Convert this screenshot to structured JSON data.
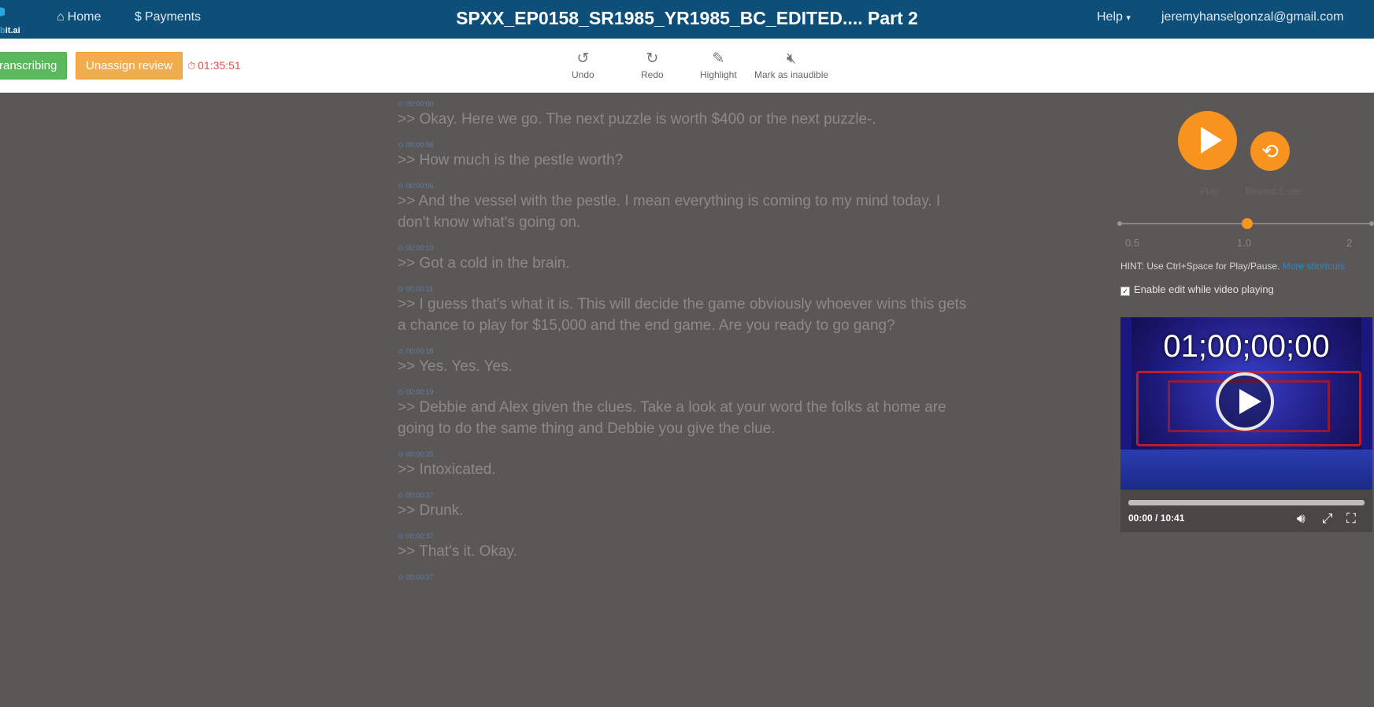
{
  "nav": {
    "logo_prefix": "b",
    "logo_suffix": "it.ai",
    "home": "Home",
    "payments": "Payments",
    "title": "SPXX_EP0158_SR1985_YR1985_BC_EDITED.... Part 2",
    "help": "Help",
    "help_caret": "▾",
    "user": "jeremyhanselgonzal@gmail.com"
  },
  "toolbar": {
    "transcribing": "ranscribing",
    "unassign": "Unassign review",
    "timer": "01:35:51",
    "undo": "Undo",
    "redo": "Redo",
    "highlight": "Highlight",
    "inaudible": "Mark as inaudible"
  },
  "transcript": [
    {
      "time": "00:00:00",
      "text": ">> Okay. Here we go. The next puzzle is worth $400 or the next puzzle-."
    },
    {
      "time": "00:00:06",
      "text": ">> How much is the pestle worth?"
    },
    {
      "time": "00:00:06",
      "text": ">> And the vessel with the pestle. I mean everything is coming to my mind today. I don't know what's going on."
    },
    {
      "time": "00:00:10",
      "text": ">> Got a cold in the brain."
    },
    {
      "time": "00:00:11",
      "text": ">> I guess that's what it is. This will decide the game obviously whoever wins this gets a chance to play for $15,000 and the end game. Are you ready to go gang?"
    },
    {
      "time": "00:00:18",
      "text": ">> Yes. Yes. Yes."
    },
    {
      "time": "00:00:19",
      "text": ">> Debbie and Alex given the clues. Take a look at your word the folks at home are going to do the same thing and Debbie you give the clue."
    },
    {
      "time": "00:00:25",
      "text": ">> Intoxicated."
    },
    {
      "time": "00:00:37",
      "text": ">> Drunk."
    },
    {
      "time": "00:00:37",
      "text": ">> That's it. Okay."
    },
    {
      "time": "00:00:37",
      "text": ""
    }
  ],
  "player": {
    "play_label": "Play",
    "rewind_label": "Rewind 5 sec",
    "speed_min": "0.5",
    "speed_mid": "1.0",
    "speed_max": "2",
    "speed_value": 1.0,
    "hint": "HINT: Use Ctrl+Space for Play/Pause.",
    "more_shortcuts": "More shortcuts",
    "enable_edit": "Enable edit while video playing",
    "enable_edit_checked": true,
    "video_overlay_time": "01;00;00;00",
    "video_time": "00:00 / 10:41"
  },
  "colors": {
    "navbar": "#0e4f7a",
    "accent": "#f7931e",
    "green": "#5cb85c",
    "orange": "#f0ad4e",
    "timer_red": "#d9534f"
  }
}
